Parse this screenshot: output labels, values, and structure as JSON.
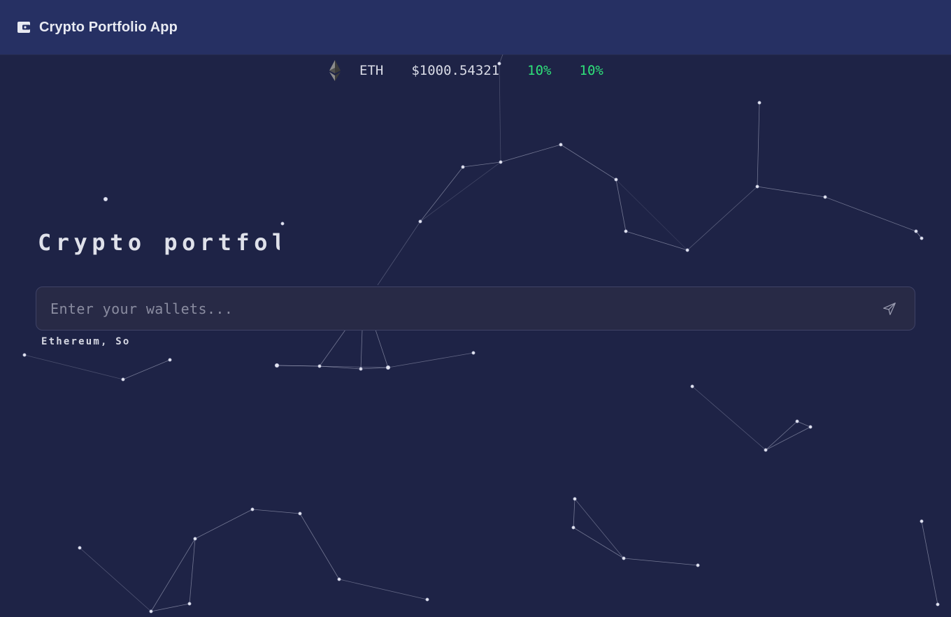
{
  "header": {
    "title": "Crypto Portfolio App",
    "logo_icon": "wallet-icon"
  },
  "ticker": {
    "icon": "ethereum-icon",
    "symbol": "ETH",
    "price": "$1000.54321",
    "change_1": "10%",
    "change_2": "10%",
    "positive_color": "#2fe17a"
  },
  "main": {
    "heading": "Crypto portfolio",
    "search": {
      "placeholder": "Enter your wallets...",
      "value": "",
      "submit_icon": "send-icon"
    },
    "hint": "Ethereum, So"
  },
  "colors": {
    "background": "#1e2346",
    "header": "#263063",
    "accent_positive": "#2fe17a"
  }
}
